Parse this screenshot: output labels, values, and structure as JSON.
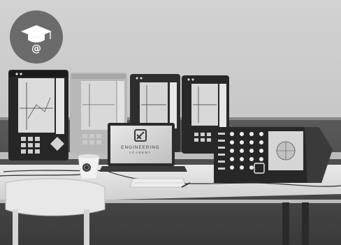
{
  "laptop": {
    "brand_line1": "ENGINEERING",
    "brand_line2": "ACADEMY"
  },
  "badge": {
    "icon": "graduation-cap-at-icon",
    "glyph": "@"
  },
  "colors": {
    "wall": "#c9c9c9",
    "floor": "#4d4d4d",
    "desk": "#e4e4e4",
    "device_dark": "#2b2b2b",
    "device_light": "#bdbdbd",
    "badge": "#6b6b6b"
  }
}
